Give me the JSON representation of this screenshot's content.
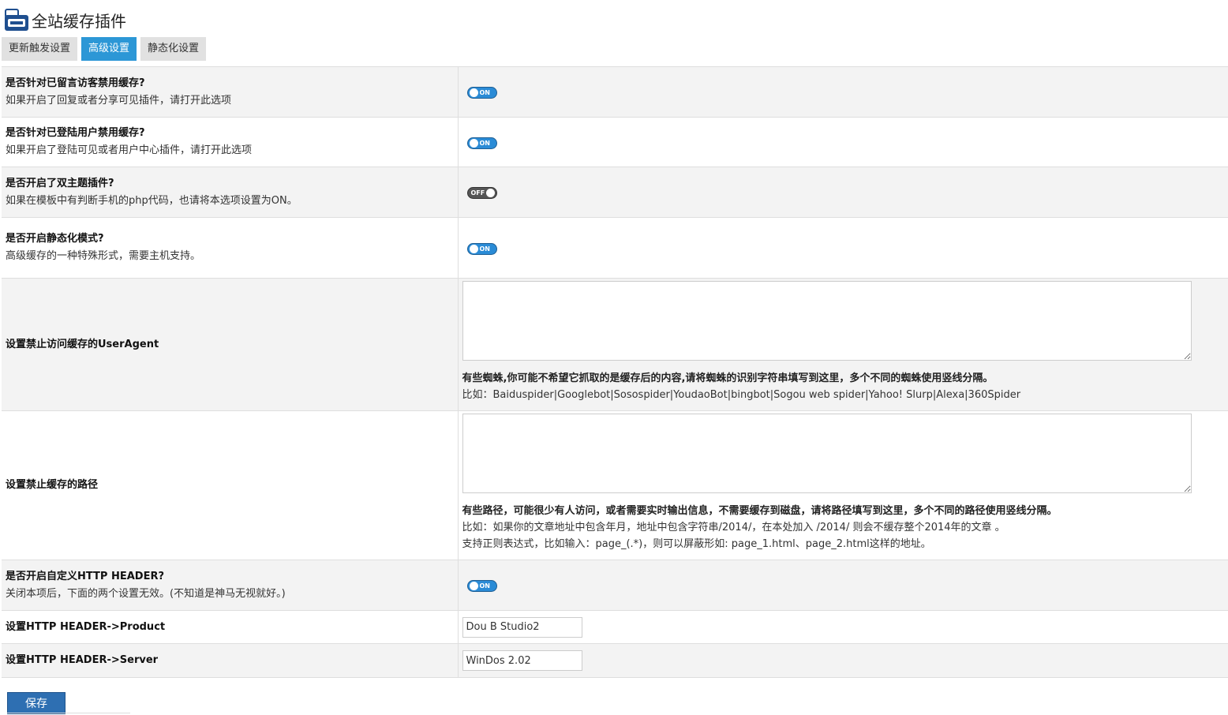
{
  "app": {
    "title": "全站缓存插件",
    "logo_icon": "folder-cache-icon"
  },
  "tabs": [
    {
      "label": "更新触发设置",
      "active": false
    },
    {
      "label": "高级设置",
      "active": true
    },
    {
      "label": "静态化设置",
      "active": false
    }
  ],
  "rows": {
    "commenter": {
      "title": "是否针对已留言访客禁用缓存?",
      "desc": "如果开启了回复或者分享可见插件，请打开此选项",
      "state": "ON"
    },
    "loggedin": {
      "title": "是否针对已登陆用户禁用缓存?",
      "desc": "如果开启了登陆可见或者用户中心插件，请打开此选项",
      "state": "ON"
    },
    "dualtheme": {
      "title": "是否开启了双主题插件?",
      "desc": "如果在模板中有判断手机的php代码，也请将本选项设置为ON。",
      "state": "OFF"
    },
    "static": {
      "title": "是否开启静态化模式?",
      "desc": "高级缓存的一种特殊形式，需要主机支持。",
      "state": "ON"
    },
    "useragent": {
      "title": "设置禁止访问缓存的UserAgent",
      "value": "",
      "help_bold": "有些蜘蛛,你可能不希望它抓取的是缓存后的内容,请将蜘蛛的识别字符串填写到这里，多个不同的蜘蛛使用竖线分隔。",
      "help_example": "比如：Baiduspider|Googlebot|Sosospider|YoudaoBot|bingbot|Sogou web spider|Yahoo! Slurp|Alexa|360Spider"
    },
    "paths": {
      "title": "设置禁止缓存的路径",
      "value": "",
      "help_bold": "有些路径，可能很少有人访问，或者需要实时输出信息，不需要缓存到磁盘，请将路径填写到这里，多个不同的路径使用竖线分隔。",
      "help_example": "比如：如果你的文章地址中包含年月，地址中包含字符串/2014/，在本处加入 /2014/ 则会不缓存整个2014年的文章 。",
      "help_regex": "支持正则表达式，比如输入：page_(.*)，则可以屏蔽形如: page_1.html、page_2.html这样的地址。"
    },
    "httpheader": {
      "title": "是否开启自定义HTTP HEADER?",
      "desc": "关闭本项后，下面的两个设置无效。(不知道是神马无视就好。)",
      "state": "ON"
    },
    "product": {
      "title": "设置HTTP HEADER->Product",
      "value": "Dou B Studio2"
    },
    "server": {
      "title": "设置HTTP HEADER->Server",
      "value": "WinDos 2.02"
    }
  },
  "save_label": "保存",
  "colors": {
    "accent": "#2c97d6",
    "toggle_on": "#2a8bd6",
    "toggle_off": "#555555",
    "save": "#2e6fb2"
  }
}
